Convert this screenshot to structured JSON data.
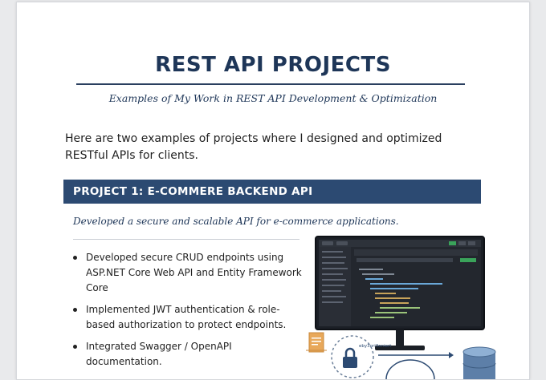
{
  "header": {
    "title": "REST API PROJECTS",
    "subtitle": "Examples of My Work in REST API Development & Optimization"
  },
  "intro": "Here are two examples of projects where I designed and optimized RESTful APIs for clients.",
  "project1": {
    "heading": "PROJECT 1: E-COMMERE BACKEND API",
    "tagline": "Developed a secure and scalable API for e-commerce applications.",
    "bullets": [
      "Developed secure CRUD endpoints using ASP.NET Core Web API and Entity Framework Core",
      "Implemented JWT authentication & role-based authorization to protect endpoints.",
      "Integrated Swagger / OpenAPI documentation."
    ]
  },
  "illustration": {
    "icons": [
      "monitor-icon",
      "lock-icon",
      "document-icon",
      "database-icon"
    ],
    "label": "eby3ori3oniert"
  },
  "colors": {
    "title": "#1e3658",
    "band": "#2c4a72",
    "accent_green": "#3aa35a"
  }
}
